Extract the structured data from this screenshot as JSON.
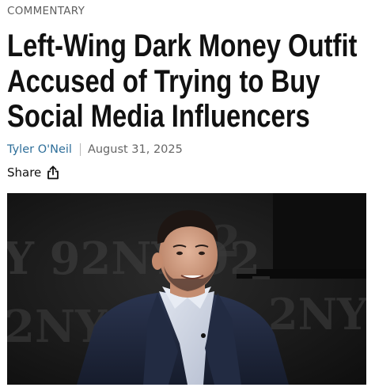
{
  "article": {
    "category": "COMMENTARY",
    "headline_lines": [
      "Left-Wing Dark Money Outfit",
      "Accused of Trying to Buy",
      "Social Media Influencers"
    ],
    "author": "Tyler O'Neil",
    "date": "August 31, 2025",
    "share_label": "Share",
    "share_icon": "share-icon",
    "photo": {
      "backdrop_text": "92NY",
      "backdrop_text_2": "2NY 92"
    }
  },
  "colors": {
    "headline": "#111111",
    "category": "#5f5f5f",
    "author_link": "#2f6f9a",
    "date": "#666666",
    "divider": "#b9b9b9",
    "photo_background": "#1b1b1b"
  }
}
